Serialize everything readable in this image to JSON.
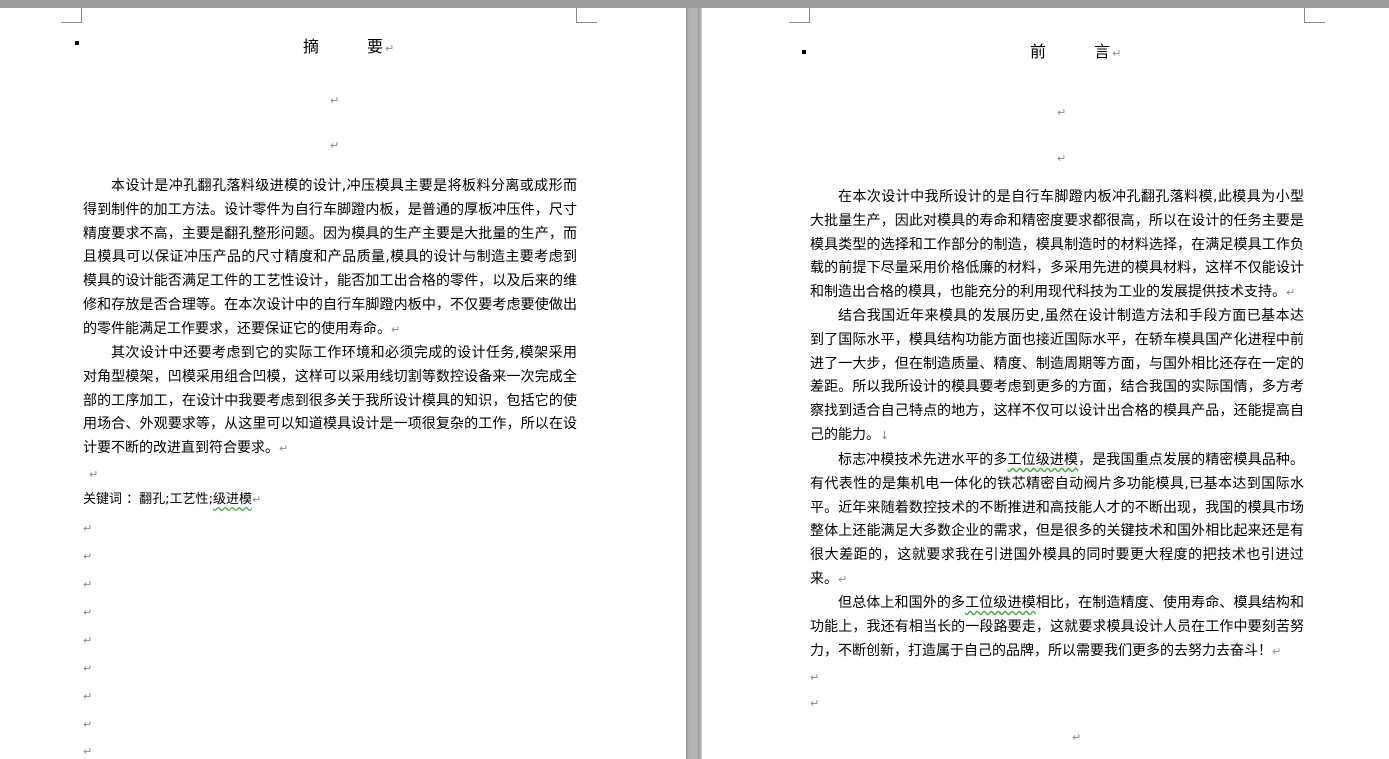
{
  "left_page": {
    "title": "摘　要",
    "para1": "本设计是冲孔翻孔落料级进模的设计,冲压模具主要是将板料分离或成形而得到制件的加工方法。设计零件为自行车脚蹬内板，是普通的厚板冲压件，尺寸精度要求不高，主要是翻孔整形问题。因为模具的生产主要是大批量的生产，而且模具可以保证冲压产品的尺寸精度和产品质量,模具的设计与制造主要考虑到模具的设计能否满足工件的工艺性设计，能否加工出合格的零件，以及后来的维修和存放是否合理等。在本次设计中的自行车脚蹬内板中，不仅要考虑要使做出的零件能满足工作要求，还要保证它的使用寿命。",
    "para2": "其次设计中还要考虑到它的实际工作环境和必须完成的设计任务,模架采用对角型模架，凹模采用组合凹模，这样可以采用线切割等数控设备来一次完成全部的工序加工，在设计中我要考虑到很多关于我所设计模具的知识，包括它的使用场合、外观要求等，从这里可以知道模具设计是一项很复杂的工作，所以在设计要不断的改进直到符合要求。",
    "keywords_label": "关键词 ：",
    "keyword1": "翻孔",
    "keyword2": "工艺性",
    "keyword3": "级进模",
    "keyword_sep": ";"
  },
  "right_page": {
    "title": "前　言",
    "para1": "在本次设计中我所设计的是自行车脚蹬内板冲孔翻孔落料模,此模具为小型大批量生产，因此对模具的寿命和精密度要求都很高，所以在设计的任务主要是模具类型的选择和工作部分的制造，模具制造时的材料选择，在满足模具工作负载的前提下尽量采用价格低廉的材料，多采用先进的模具材料，这样不仅能设计和制造出合格的模具，也能充分的利用现代科技为工业的发展提供技术支持。",
    "para2": "结合我国近年来模具的发展历史,虽然在设计制造方法和手段方面已基本达到了国际水平，模具结构功能方面也接近国际水平，在轿车模具国产化进程中前进了一大步，但在制造质量、精度、制造周期等方面，与国外相比还存在一定的差距。所以我所设计的模具要考虑到更多的方面，结合我国的实际国情，多方考察找到适合自己特点的地方，这样不仅可以设计出合格的模具产品，还能提高自己的能力。",
    "para3_a": "标志冲模技术先进水平的多",
    "para3_term": "工位级进模",
    "para3_b": "，是我国重点发展的精密模具品种。有代表性的是集机电一体化的铁芯精密自动阀片多功能模具,已基本达到国际水平。近年来随着数控技术的不断推进和高技能人才的不断出现，我国的模具市场整体上还能满足大多数企业的需求，但是很多的关键技术和国外相比起来还是有很大差距的，这就要求我在引进国外模具的同时要更大程度的把技术也引进过来。",
    "para4_a": "但总体上和国外的多",
    "para4_term": "工位级进模",
    "para4_b": "相比，在制造精度、使用寿命、模具结构和功能上，我还有相当长的一段路要走，这就要求模具设计人员在工作中要刻苦努力，不断创新，打造属于自己的品牌，所以需要我们更多的去努力去奋斗！"
  },
  "marks": {
    "paragraph": "↵",
    "line_break": "↓"
  }
}
